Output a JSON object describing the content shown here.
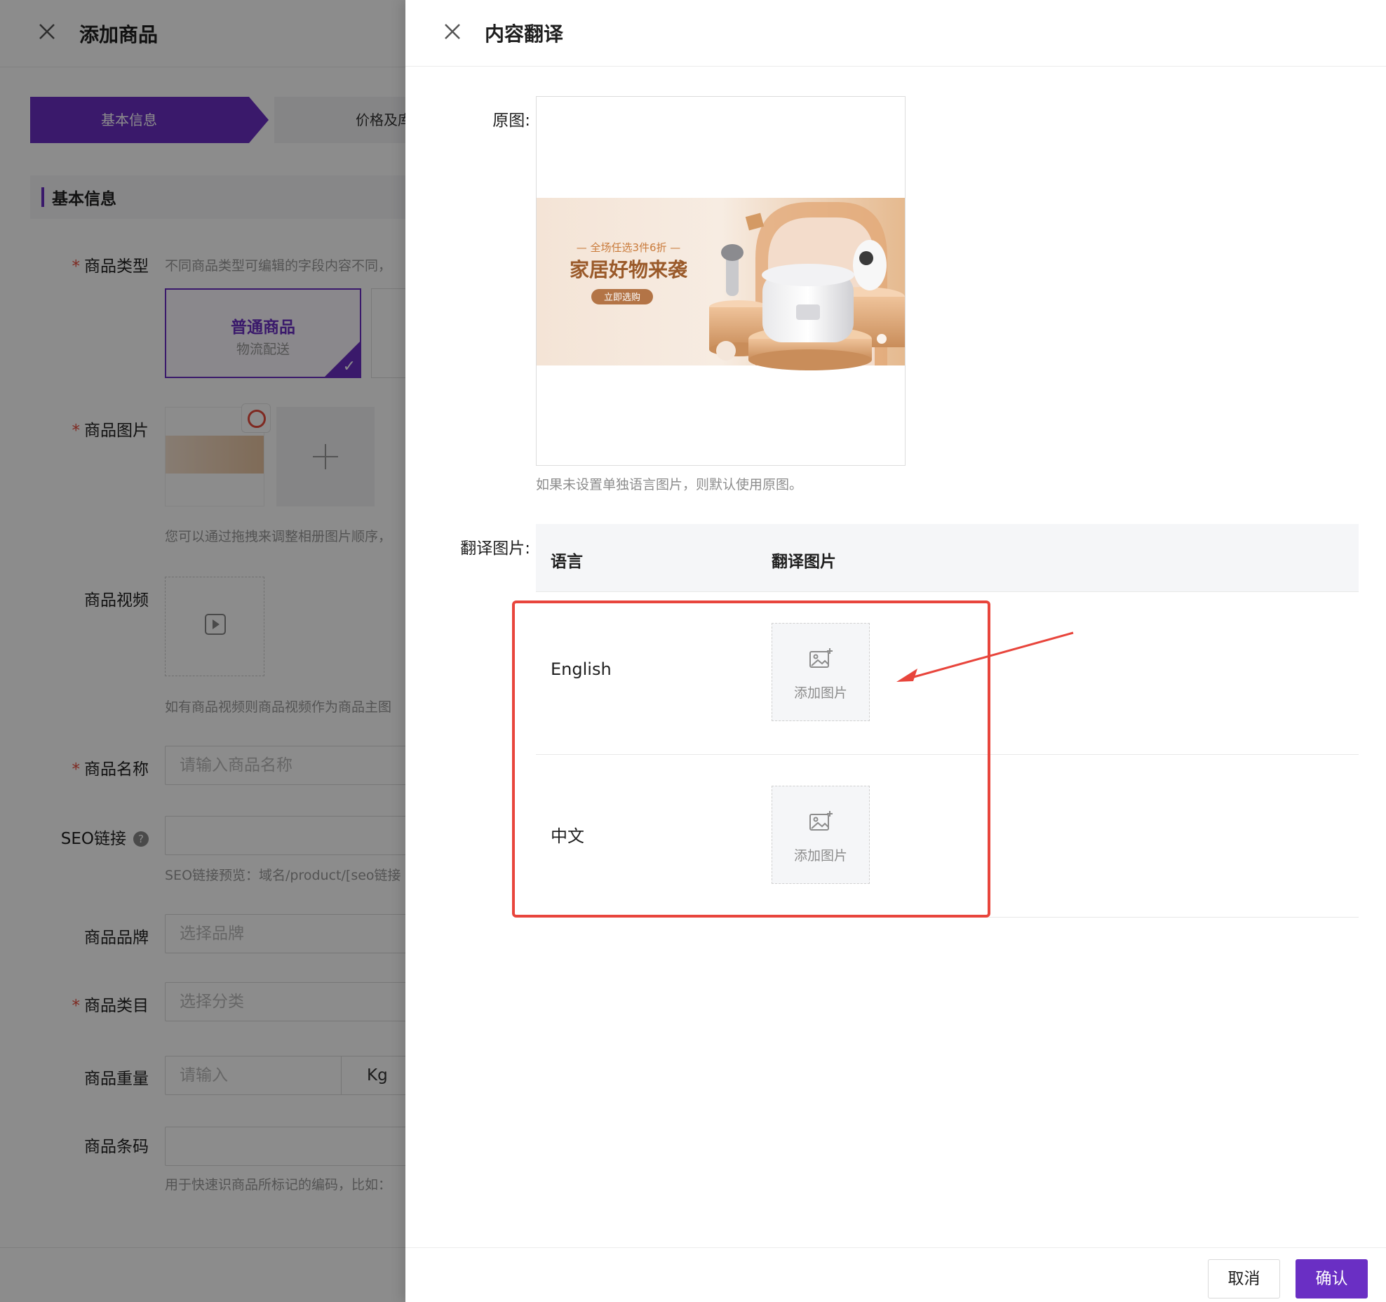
{
  "background_page": {
    "title": "添加商品",
    "steps": [
      "基本信息",
      "价格及库存"
    ],
    "section_title": "基本信息",
    "product_type": {
      "label": "商品类型",
      "hint": "不同商品类型可编辑的字段内容不同，",
      "card_title": "普通商品",
      "card_subtitle": "物流配送"
    },
    "product_images": {
      "label": "商品图片",
      "hint": "您可以通过拖拽来调整相册图片顺序，"
    },
    "product_video": {
      "label": "商品视频",
      "hint": "如有商品视频则商品视频作为商品主图"
    },
    "product_name": {
      "label": "商品名称",
      "placeholder": "请输入商品名称"
    },
    "seo_link": {
      "label": "SEO链接",
      "help": "?",
      "hint": "SEO链接预览：域名/product/[seo链接"
    },
    "brand": {
      "label": "商品品牌",
      "placeholder": "选择品牌"
    },
    "category": {
      "label": "商品类目",
      "placeholder": "选择分类"
    },
    "weight": {
      "label": "商品重量",
      "placeholder": "请输入",
      "unit": "Kg"
    },
    "barcode": {
      "label": "商品条码",
      "hint": "用于快速识商品所标记的编码，比如："
    },
    "required_mark": "*"
  },
  "drawer": {
    "title": "内容翻译",
    "original_label": "原图:",
    "original_image": {
      "line1": "— 全场任选3件6折 —",
      "line2": "家居好物来袭",
      "button": "立即选购"
    },
    "original_hint": "如果未设置单独语言图片，则默认使用原图。",
    "translated_label": "翻译图片:",
    "table": {
      "headers": [
        "语言",
        "翻译图片"
      ],
      "rows": [
        {
          "language": "English",
          "upload_text": "添加图片"
        },
        {
          "language": "中文",
          "upload_text": "添加图片"
        }
      ]
    },
    "footer": {
      "cancel": "取消",
      "confirm": "确认"
    }
  },
  "colors": {
    "accent": "#6a2fc4",
    "annotation_red": "#e8453c",
    "overlay": "rgba(0,0,0,0.45)"
  },
  "icons": [
    "close-icon",
    "image-add-icon",
    "plus-icon",
    "video-icon",
    "chevron-down-icon",
    "help-icon",
    "check-icon",
    "translate-icon"
  ]
}
